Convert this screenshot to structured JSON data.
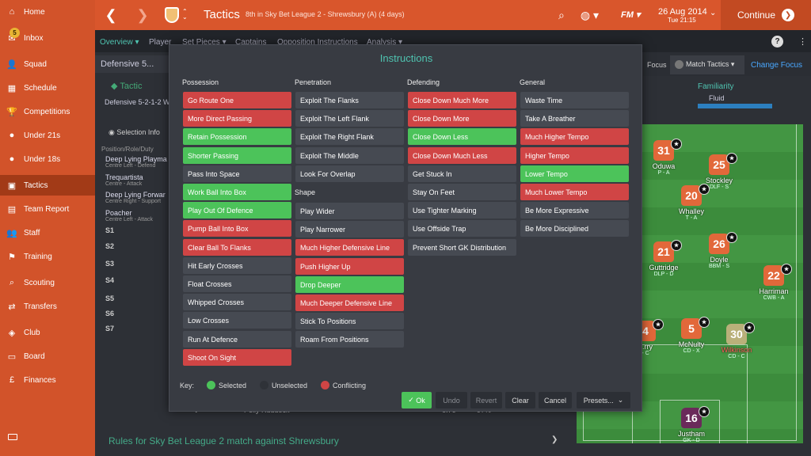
{
  "sidebar": {
    "items": [
      {
        "label": "Home",
        "icon": "home-icon"
      },
      {
        "label": "Inbox",
        "icon": "inbox-icon",
        "badge": "5"
      },
      {
        "label": "Squad",
        "icon": "squad-icon"
      },
      {
        "label": "Schedule",
        "icon": "schedule-icon"
      },
      {
        "label": "Competitions",
        "icon": "trophy-icon"
      },
      {
        "label": "Under 21s",
        "icon": "under21-icon"
      },
      {
        "label": "Under 18s",
        "icon": "under18-icon"
      },
      {
        "label": "Tactics",
        "icon": "tactics-icon"
      },
      {
        "label": "Team Report",
        "icon": "report-icon"
      },
      {
        "label": "Staff",
        "icon": "staff-icon"
      },
      {
        "label": "Training",
        "icon": "training-icon"
      },
      {
        "label": "Scouting",
        "icon": "scouting-icon"
      },
      {
        "label": "Transfers",
        "icon": "transfers-icon"
      },
      {
        "label": "Club",
        "icon": "club-icon"
      },
      {
        "label": "Board",
        "icon": "board-icon"
      },
      {
        "label": "Finances",
        "icon": "finances-icon"
      }
    ]
  },
  "topbar": {
    "title": "Tactics",
    "subtitle": "8th in Sky Bet League 2 - Shrewsbury (A) (4 days)",
    "logo": "FM",
    "date": "26 Aug 2014",
    "time": "Tue 21:15",
    "continue": "Continue"
  },
  "subnav": {
    "items": [
      "Overview",
      "Player",
      "Set Pieces",
      "Captains",
      "Opposition Instructions",
      "Analysis"
    ],
    "help": "?"
  },
  "background": {
    "formation": "Defensive 5...",
    "tactic_label": "Tactic",
    "tactic_name": "Defensive 5-2-1-2 W",
    "selection_info": "Selection Info",
    "position_header": "Position/Role/Duty",
    "roles": [
      {
        "name": "Deep Lying Playma",
        "detail": "Centre Left - Defend"
      },
      {
        "name": "Trequartista",
        "detail": "Centre - Attack"
      },
      {
        "name": "Deep Lying Forwar",
        "detail": "Centre Right - Support"
      },
      {
        "name": "Poacher",
        "detail": "Centre Left - Attack"
      }
    ],
    "subs": [
      "S1",
      "S2",
      "S3",
      "S4",
      "S5",
      "S6",
      "S7"
    ],
    "focus": "Focus",
    "match_tactics": "Match Tactics",
    "change_focus": "Change Focus",
    "familiarity": "Familiarity",
    "familiarity_value": "Fluid",
    "bottom_player": "Pelly Ruddock",
    "bottom_rating": "6.76",
    "bottom_percent": "97%",
    "rules_text": "Rules for Sky Bet League 2 match against Shrewsbury",
    "pitch_players": [
      {
        "number": "31",
        "name": "Oduwa",
        "role": "P - A"
      },
      {
        "number": "25",
        "name": "Stockley",
        "role": "DLF - S"
      },
      {
        "number": "20",
        "name": "Whalley",
        "role": "T - A"
      },
      {
        "number": "21",
        "name": "Guttridge",
        "role": "DLP - D"
      },
      {
        "number": "26",
        "name": "Doyle",
        "role": "BBM - S"
      },
      {
        "number": "22",
        "name": "Harriman",
        "role": "CWB - A"
      },
      {
        "number": "4",
        "name": "...rry",
        "role": "- C"
      },
      {
        "number": "5",
        "name": "McNulty",
        "role": "CD - X"
      },
      {
        "number": "30",
        "name": "Wilkinson",
        "role": "CD - C"
      },
      {
        "number": "16",
        "name": "Justham",
        "role": "GK - D"
      }
    ]
  },
  "modal": {
    "title": "Instructions",
    "columns": {
      "possession": {
        "header": "Possession",
        "items": [
          {
            "label": "Go Route One",
            "state": "conflicting"
          },
          {
            "label": "More Direct Passing",
            "state": "conflicting"
          },
          {
            "label": "Retain Possession",
            "state": "selected"
          },
          {
            "label": "Shorter Passing",
            "state": "selected"
          },
          {
            "label": "Pass Into Space",
            "state": "unselected"
          },
          {
            "label": "Work Ball Into Box",
            "state": "selected"
          },
          {
            "label": "Play Out Of Defence",
            "state": "selected"
          },
          {
            "label": "Pump Ball Into Box",
            "state": "conflicting"
          },
          {
            "label": "Clear Ball To Flanks",
            "state": "conflicting"
          },
          {
            "label": "Hit Early Crosses",
            "state": "unselected"
          },
          {
            "label": "Float Crosses",
            "state": "unselected"
          },
          {
            "label": "Whipped Crosses",
            "state": "unselected"
          },
          {
            "label": "Low Crosses",
            "state": "unselected"
          },
          {
            "label": "Run At Defence",
            "state": "unselected"
          },
          {
            "label": "Shoot On Sight",
            "state": "conflicting"
          }
        ]
      },
      "penetration": {
        "header": "Penetration",
        "items": [
          {
            "label": "Exploit The Flanks",
            "state": "unselected"
          },
          {
            "label": "Exploit The Left Flank",
            "state": "unselected"
          },
          {
            "label": "Exploit The Right Flank",
            "state": "unselected"
          },
          {
            "label": "Exploit The Middle",
            "state": "unselected"
          },
          {
            "label": "Look For Overlap",
            "state": "unselected"
          }
        ]
      },
      "shape": {
        "header": "Shape",
        "items": [
          {
            "label": "Play Wider",
            "state": "unselected"
          },
          {
            "label": "Play Narrower",
            "state": "unselected"
          },
          {
            "label": "Much Higher Defensive Line",
            "state": "conflicting"
          },
          {
            "label": "Push Higher Up",
            "state": "conflicting"
          },
          {
            "label": "Drop Deeper",
            "state": "selected"
          },
          {
            "label": "Much Deeper Defensive Line",
            "state": "conflicting"
          },
          {
            "label": "Stick To Positions",
            "state": "unselected"
          },
          {
            "label": "Roam From Positions",
            "state": "unselected"
          }
        ]
      },
      "defending": {
        "header": "Defending",
        "items": [
          {
            "label": "Close Down Much More",
            "state": "conflicting"
          },
          {
            "label": "Close Down More",
            "state": "conflicting"
          },
          {
            "label": "Close Down Less",
            "state": "selected"
          },
          {
            "label": "Close Down Much Less",
            "state": "conflicting"
          },
          {
            "label": "Get Stuck In",
            "state": "unselected"
          },
          {
            "label": "Stay On Feet",
            "state": "unselected"
          },
          {
            "label": "Use Tighter Marking",
            "state": "unselected"
          },
          {
            "label": "Use Offside Trap",
            "state": "unselected"
          },
          {
            "label": "Prevent Short GK Distribution",
            "state": "unselected"
          }
        ]
      },
      "general": {
        "header": "General",
        "items": [
          {
            "label": "Waste Time",
            "state": "unselected"
          },
          {
            "label": "Take A Breather",
            "state": "unselected"
          },
          {
            "label": "Much Higher Tempo",
            "state": "conflicting"
          },
          {
            "label": "Higher Tempo",
            "state": "conflicting"
          },
          {
            "label": "Lower Tempo",
            "state": "selected"
          },
          {
            "label": "Much Lower Tempo",
            "state": "conflicting"
          },
          {
            "label": "Be More Expressive",
            "state": "unselected"
          },
          {
            "label": "Be More Disciplined",
            "state": "unselected"
          }
        ]
      }
    },
    "key": {
      "label": "Key:",
      "selected": "Selected",
      "unselected": "Unselected",
      "conflicting": "Conflicting"
    },
    "buttons": {
      "ok": "Ok",
      "undo": "Undo",
      "revert": "Revert",
      "clear": "Clear",
      "cancel": "Cancel",
      "presets": "Presets..."
    }
  },
  "colors": {
    "selected": "#4cc35a",
    "conflicting": "#d04545",
    "unselected": "#464a52",
    "accent": "#4fc3b0",
    "brand": "#d9562c"
  }
}
